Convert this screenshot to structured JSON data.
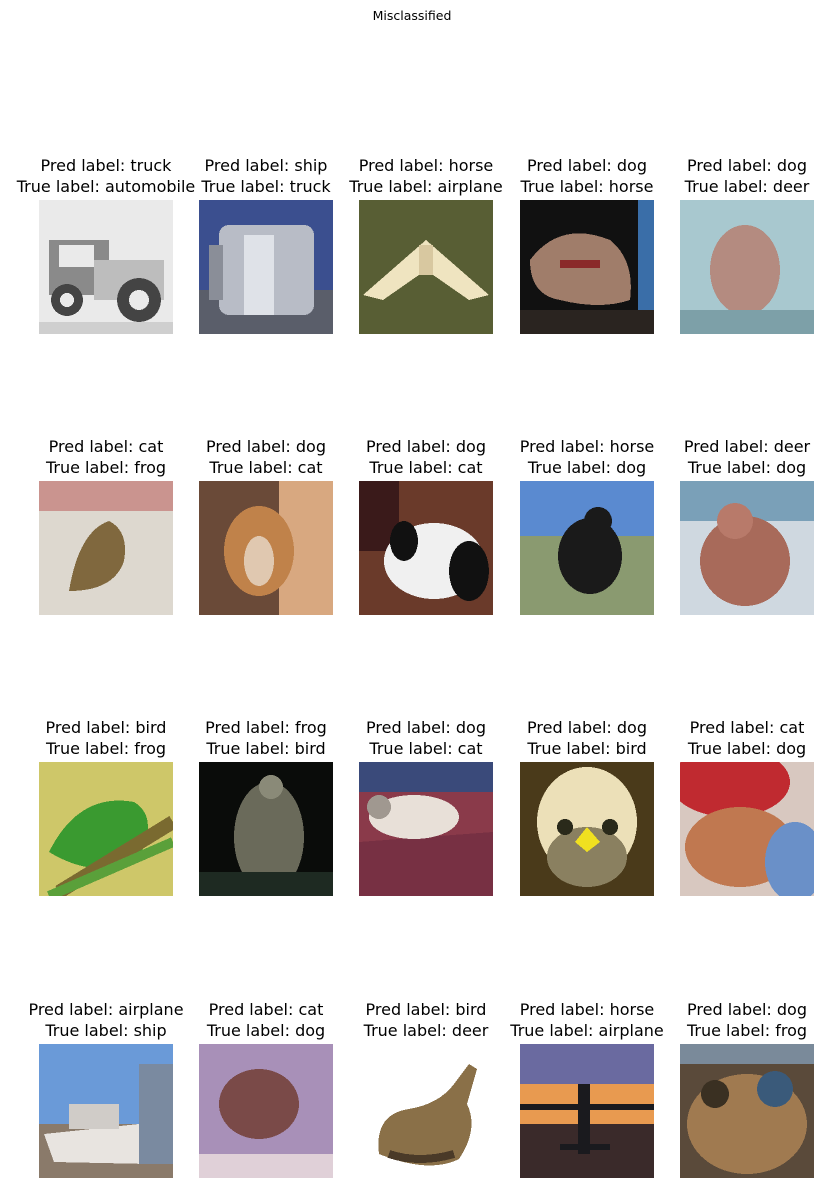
{
  "figure": {
    "title": "Misclassified"
  },
  "rows": [
    [
      {
        "pred": "Pred label: truck",
        "true": "True label: automobile",
        "subject": "automobile-photo",
        "palette": [
          "#eaeaea",
          "#444444",
          "#8a8a8a"
        ]
      },
      {
        "pred": "Pred label: ship",
        "true": "True label: truck",
        "subject": "truck-photo",
        "palette": [
          "#3b4f8f",
          "#b8bcc6",
          "#5a5e6a"
        ]
      },
      {
        "pred": "Pred label: horse",
        "true": "True label: airplane",
        "subject": "airplane-photo",
        "palette": [
          "#4f5a2e",
          "#efe4c0",
          "#6b6640"
        ]
      },
      {
        "pred": "Pred label: dog",
        "true": "True label: horse",
        "subject": "horse-photo",
        "palette": [
          "#111111",
          "#a07d6a",
          "#3a6ea8"
        ]
      },
      {
        "pred": "Pred label: dog",
        "true": "True label: deer",
        "subject": "deer-photo",
        "palette": [
          "#a8c8cf",
          "#b48b80",
          "#7da0a8"
        ]
      }
    ],
    [
      {
        "pred": "Pred label: cat",
        "true": "True label: frog",
        "subject": "frog-photo",
        "palette": [
          "#ddd8cf",
          "#80683e",
          "#b85050"
        ]
      },
      {
        "pred": "Pred label: dog",
        "true": "True label: cat",
        "subject": "cat-photo",
        "palette": [
          "#6a4a38",
          "#c0824a",
          "#e0c8b0"
        ]
      },
      {
        "pred": "Pred label: dog",
        "true": "True label: cat",
        "subject": "cat-photo",
        "palette": [
          "#6a3a2a",
          "#f0f0f0",
          "#111111"
        ]
      },
      {
        "pred": "Pred label: horse",
        "true": "True label: dog",
        "subject": "dog-photo",
        "palette": [
          "#5a8ad0",
          "#1a1a1a",
          "#8a9a70"
        ]
      },
      {
        "pred": "Pred label: deer",
        "true": "True label: dog",
        "subject": "dog-photo",
        "palette": [
          "#cfd8e0",
          "#a86a5a",
          "#7aa0b8"
        ]
      }
    ],
    [
      {
        "pred": "Pred label: bird",
        "true": "True label: frog",
        "subject": "frog-photo",
        "palette": [
          "#d8d070",
          "#3a9a30",
          "#7a6a30"
        ]
      },
      {
        "pred": "Pred label: frog",
        "true": "True label: bird",
        "subject": "bird-photo",
        "palette": [
          "#0a0c0a",
          "#6a6a5a",
          "#1e2a22"
        ]
      },
      {
        "pred": "Pred label: dog",
        "true": "True label: cat",
        "subject": "cat-photo",
        "palette": [
          "#8a3a4a",
          "#e8e0d8",
          "#3a4a7a"
        ]
      },
      {
        "pred": "Pred label: dog",
        "true": "True label: bird",
        "subject": "bird-photo",
        "palette": [
          "#4a3a1a",
          "#ece0b8",
          "#f0e020"
        ]
      },
      {
        "pred": "Pred label: cat",
        "true": "True label: dog",
        "subject": "dog-photo",
        "palette": [
          "#c02a30",
          "#c07850",
          "#6a90c8"
        ]
      }
    ],
    [
      {
        "pred": "Pred label: airplane",
        "true": "True label: ship",
        "subject": "ship-photo",
        "palette": [
          "#6a9ad8",
          "#e8e4e0",
          "#8a7a6a"
        ]
      },
      {
        "pred": "Pred label: cat",
        "true": "True label: dog",
        "subject": "dog-photo",
        "palette": [
          "#a890b8",
          "#7a4a48",
          "#e0d0d8"
        ]
      },
      {
        "pred": "Pred label: bird",
        "true": "True label: deer",
        "subject": "deer-photo",
        "palette": [
          "#ffffff",
          "#8a7048",
          "#4a3a28"
        ]
      },
      {
        "pred": "Pred label: horse",
        "true": "True label: airplane",
        "subject": "airplane-photo",
        "palette": [
          "#e89a50",
          "#1a1a1e",
          "#6a6aa0"
        ]
      },
      {
        "pred": "Pred label: dog",
        "true": "True label: frog",
        "subject": "frog-photo",
        "palette": [
          "#5a4a3a",
          "#a07a50",
          "#3a5a7a"
        ]
      }
    ]
  ]
}
